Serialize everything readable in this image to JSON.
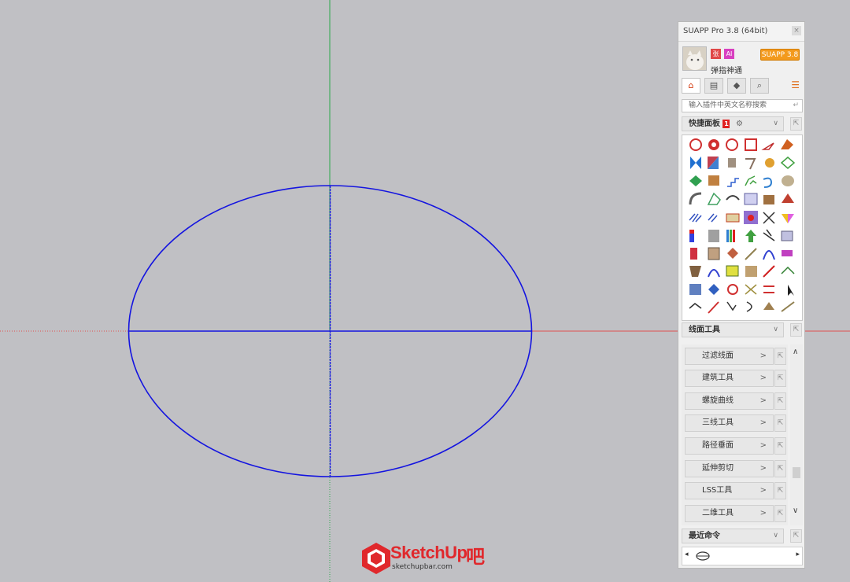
{
  "panel": {
    "title": "SUAPP Pro 3.8 (64bit)",
    "close_label": "×",
    "username": "弹指神通",
    "badges": [
      "张",
      "AI"
    ],
    "version_button": "SUAPP 3.8",
    "tabs": [
      {
        "icon": "home-icon",
        "glyph": "⌂"
      },
      {
        "icon": "panel-icon",
        "glyph": "▤"
      },
      {
        "icon": "paint-bucket-icon",
        "glyph": "◆"
      },
      {
        "icon": "search-icon",
        "glyph": "⌕"
      }
    ],
    "menu_glyph": "☰",
    "search_placeholder": "输入插件中英文名称搜索",
    "search_enter_glyph": "↵",
    "quick_panel": {
      "label": "快捷面板",
      "badge": "1",
      "gear_glyph": "⚙",
      "chevron": "∨",
      "ext_glyph": "⇱"
    },
    "line_tools": {
      "label": "线面工具",
      "chevron": "∨",
      "ext_glyph": "⇱"
    },
    "categories": [
      {
        "label": "过滤线面",
        "arrow": ">",
        "ext_glyph": "⇱"
      },
      {
        "label": "建筑工具",
        "arrow": ">",
        "ext_glyph": "⇱"
      },
      {
        "label": "螺旋曲线",
        "arrow": ">",
        "ext_glyph": "⇱"
      },
      {
        "label": "三线工具",
        "arrow": ">",
        "ext_glyph": "⇱"
      },
      {
        "label": "路径垂面",
        "arrow": ">",
        "ext_glyph": "⇱"
      },
      {
        "label": "延伸剪切",
        "arrow": ">",
        "ext_glyph": "⇱"
      },
      {
        "label": "LSS工具",
        "arrow": ">",
        "ext_glyph": "⇱"
      },
      {
        "label": "二维工具",
        "arrow": ">",
        "ext_glyph": "⇱"
      }
    ],
    "scroll_up_glyph": "∧",
    "scroll_down_glyph": "∨",
    "recent": {
      "label": "最近命令",
      "chevron": "∨",
      "ext_glyph": "⇱",
      "left_glyph": "◂",
      "right_glyph": "▸"
    }
  },
  "logo": {
    "brand": "SketchUp",
    "suffix": "吧",
    "url_text": "sketchupbar.com"
  },
  "colors": {
    "ellipse": "#1010e0",
    "green_axis": "#22aa22",
    "red_axis": "#e05050",
    "canvas": "#c0c0c4",
    "accent": "#f39a1d"
  }
}
